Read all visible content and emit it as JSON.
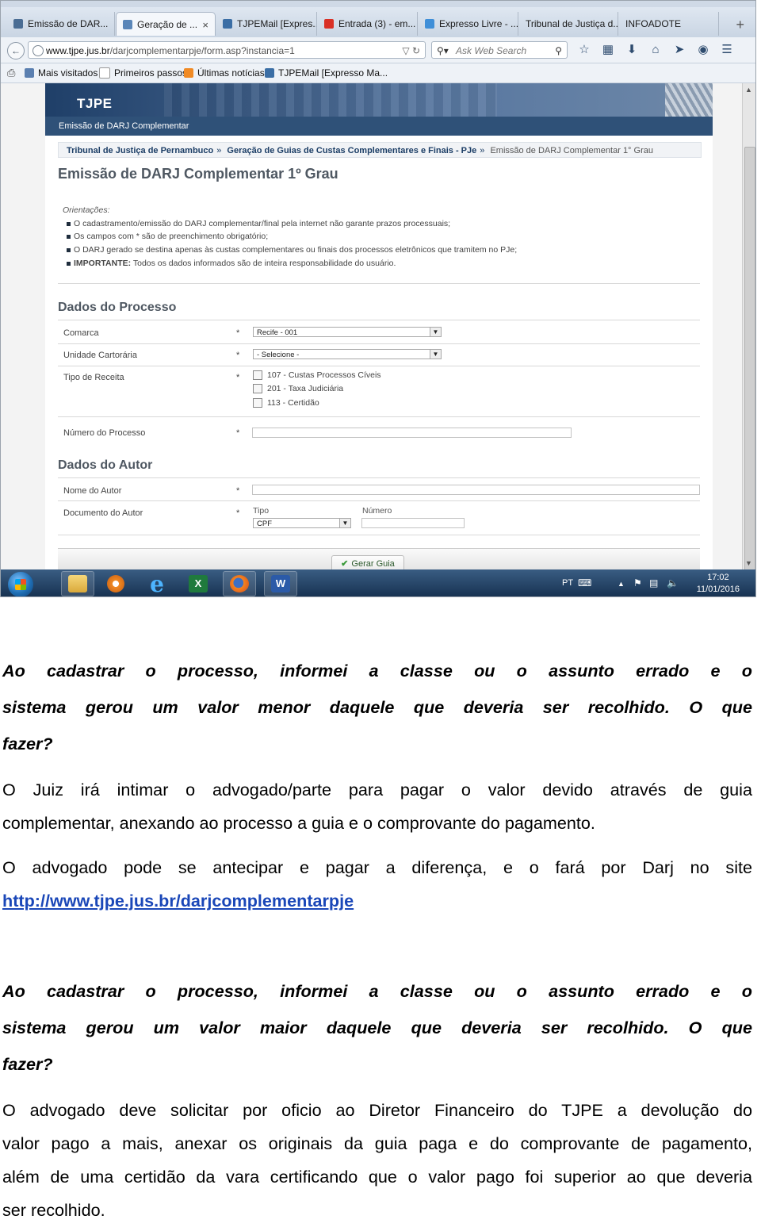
{
  "browser": {
    "tabs": [
      {
        "label": "Emissão de DAR...",
        "icon_color": "#4a6d94"
      },
      {
        "label": "Geração de ...",
        "icon_color": "#5a86b8",
        "active": true
      },
      {
        "label": "TJPEMail [Expres...",
        "icon_color": "#3b6ea5"
      },
      {
        "label": "Entrada (3) - em...",
        "icon_color": "#d93025"
      },
      {
        "label": "Expresso Livre - ...",
        "icon_color": "#3f8fd8"
      },
      {
        "label": "Tribunal de Justiça d...",
        "icon_color": "#777777"
      },
      {
        "label": "INFOADOTE",
        "icon_color": "#999999"
      }
    ],
    "close_symbol": "×",
    "new_tab_symbol": "+",
    "url_host": "www.tjpe.jus.br",
    "url_path": "/darjcomplementarpje/form.asp?instancia=1",
    "search_placeholder": "Ask Web Search",
    "bookmarks": [
      {
        "label": "Mais visitados",
        "icon_color": "#5a7fb0"
      },
      {
        "label": "Primeiros passos",
        "icon_color": "#ffffff"
      },
      {
        "label": "Últimas notícias",
        "icon_color": "#f08a24"
      },
      {
        "label": "TJPEMail [Expresso Ma...",
        "icon_color": "#3b6ea5"
      }
    ]
  },
  "site": {
    "logo": "TJPE",
    "subbar": "Emissão de DARJ Complementar",
    "breadcrumb": {
      "item1": "Tribunal de Justiça de Pernambuco",
      "item2": "Geração de Guias de Custas Complementares e Finais - PJe",
      "current": "Emissão de DARJ Complementar 1° Grau",
      "sep": "»"
    },
    "page_title": "Emissão de DARJ Complementar 1º Grau",
    "orientations_head": "Orientações:",
    "orientations": [
      "O cadastramento/emissão do DARJ complementar/final pela internet não garante prazos processuais;",
      "Os campos com * são de preenchimento obrigatório;",
      "O DARJ gerado se destina apenas às custas complementares ou finais dos processos eletrônicos que tramitem no PJe;"
    ],
    "important_label": "IMPORTANTE:",
    "important_text": " Todos os dados informados são de inteira responsabilidade do usuário.",
    "section_process": "Dados do Processo",
    "section_author": "Dados do Autor",
    "required_mark": "*",
    "fields": {
      "comarca_label": "Comarca",
      "comarca_value": "Recife - 001",
      "unidade_label": "Unidade Cartorária",
      "unidade_value": "- Selecione -",
      "tipo_receita_label": "Tipo de Receita",
      "receitas": [
        "107 - Custas Processos Cíveis",
        "201 - Taxa Judiciária",
        "113 - Certidão"
      ],
      "numero_processo_label": "Número do Processo",
      "nome_autor_label": "Nome do Autor",
      "documento_autor_label": "Documento do Autor",
      "tipo_label": "Tipo",
      "tipo_value": "CPF",
      "numero_label": "Número"
    },
    "submit_button": "Gerar Guia"
  },
  "taskbar": {
    "lang": "PT",
    "time": "17:02",
    "date": "11/01/2016"
  },
  "article": {
    "q1_l1": "Ao cadastrar o processo, informei a classe ou o assunto errado e o",
    "q1_l2": "sistema gerou um valor menor daquele que deveria ser recolhido. O que",
    "q1_l3": "fazer?",
    "a1_l1": "O Juiz irá intimar o advogado/parte para pagar o valor devido através de guia",
    "a1_l2": "complementar, anexando ao processo a guia e o comprovante do pagamento.",
    "a2_l1": "O advogado pode se antecipar e pagar a diferença, e o fará por Darj no site",
    "a2_link": "http://www.tjpe.jus.br/darjcomplementarpje",
    "q2_l1": "Ao cadastrar o processo, informei a classe ou o assunto errado e o",
    "q2_l2": "sistema gerou um valor maior daquele que deveria ser recolhido. O que",
    "q2_l3": "fazer?",
    "a3_l1": "O advogado deve solicitar por oficio ao Diretor Financeiro do TJPE a devolução do",
    "a3_l2": "valor pago a mais, anexar os originais da guia paga e do comprovante de pagamento,",
    "a3_l3": "além de uma certidão da vara certificando que o valor pago foi superior ao que deveria",
    "a3_l4": "ser recolhido."
  }
}
